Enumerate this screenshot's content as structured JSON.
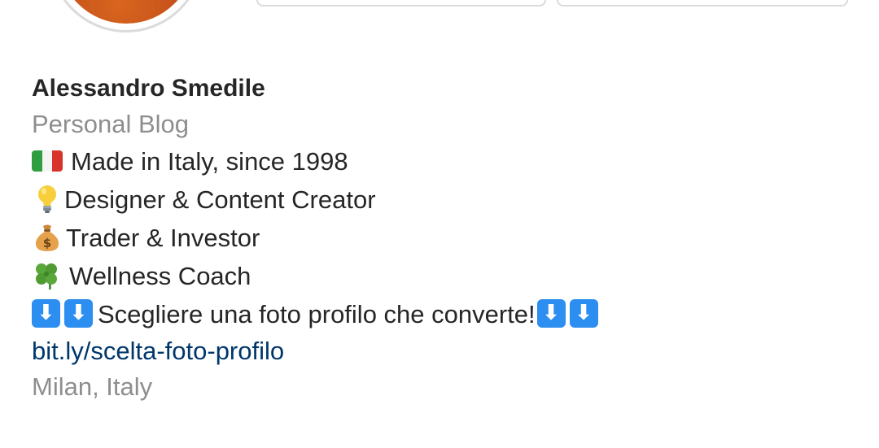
{
  "profile": {
    "name": "Alessandro Smedile",
    "category": "Personal Blog",
    "bio_lines": [
      {
        "icon": "italy-flag-icon",
        "text": "Made in Italy, since 1998"
      },
      {
        "icon": "light-bulb-icon",
        "text": "Designer & Content Creator"
      },
      {
        "icon": "money-bag-icon",
        "text": "Trader & Investor"
      },
      {
        "icon": "four-leaf-clover-icon",
        "text": "Wellness Coach"
      },
      {
        "icon": "down-arrow-icon",
        "text": "Scegliere una foto profilo che converte!"
      }
    ],
    "link": "bit.ly/scelta-foto-profilo",
    "location": "Milan, Italy"
  },
  "arrow_glyph": "⬇",
  "colors": {
    "link": "#00376b",
    "secondary_text": "#8e8e8e",
    "primary_text": "#262626",
    "arrow_key": "#2b8ef0"
  }
}
